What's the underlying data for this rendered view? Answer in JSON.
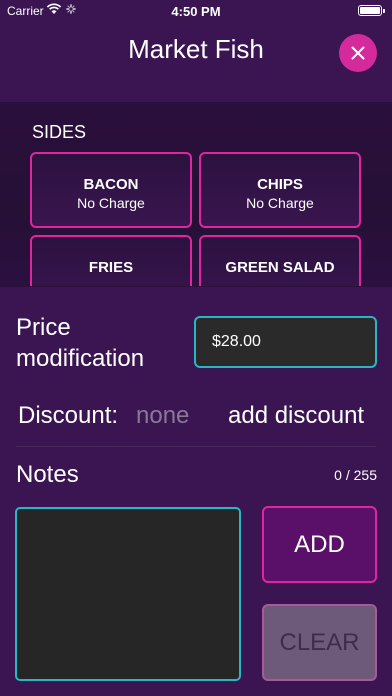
{
  "status_bar": {
    "carrier": "Carrier",
    "time": "4:50 PM"
  },
  "header": {
    "title": "Market Fish",
    "close_icon": "close-icon",
    "accent_color": "#d42a9c"
  },
  "sides": {
    "label": "SIDES",
    "items": [
      {
        "name": "BACON",
        "price": "No Charge"
      },
      {
        "name": "CHIPS",
        "price": "No Charge"
      },
      {
        "name": "FRIES",
        "price": ""
      },
      {
        "name": "GREEN SALAD",
        "price": ""
      }
    ]
  },
  "price_modification": {
    "label": "Price modification",
    "value": "$28.00"
  },
  "discount": {
    "label": "Discount:",
    "value": "none",
    "action_label": "add discount"
  },
  "notes": {
    "label": "Notes",
    "count": "0 / 255",
    "value": ""
  },
  "buttons": {
    "add_label": "ADD",
    "clear_label": "CLEAR"
  },
  "colors": {
    "background": "#3a1552",
    "tile_border": "#e0269e",
    "input_border": "#29b5c4"
  }
}
